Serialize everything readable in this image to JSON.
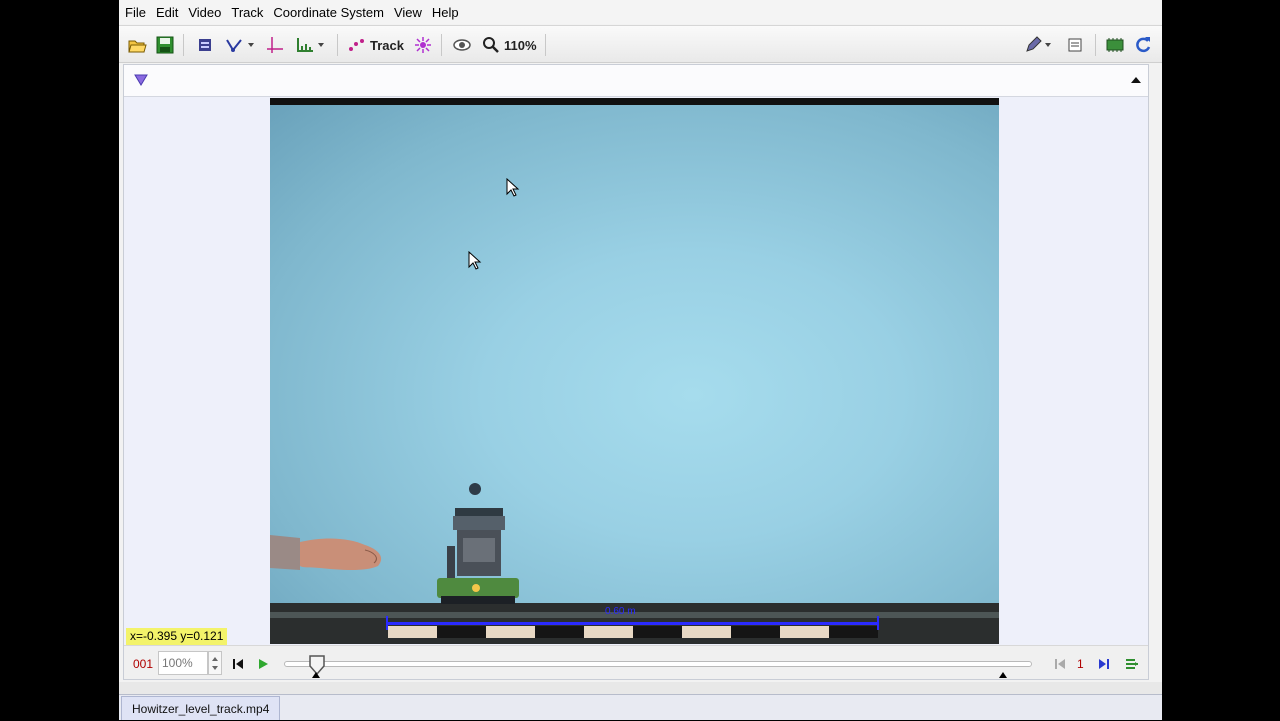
{
  "menu": [
    "File",
    "Edit",
    "Video",
    "Track",
    "Coordinate System",
    "View",
    "Help"
  ],
  "toolbar": {
    "track_label": "Track",
    "zoom_label": "110%"
  },
  "video": {
    "scale_label": "0.60 m"
  },
  "readout": {
    "coords": "x=-0.395  y=0.121"
  },
  "player": {
    "frame": "001",
    "rate": "100%",
    "step_size": "1"
  },
  "tab": {
    "filename": "Howitzer_level_track.mp4"
  },
  "colors": {
    "accent": "#2a2aff",
    "frame_red": "#b00000",
    "readout_bg": "#f3f36a"
  }
}
